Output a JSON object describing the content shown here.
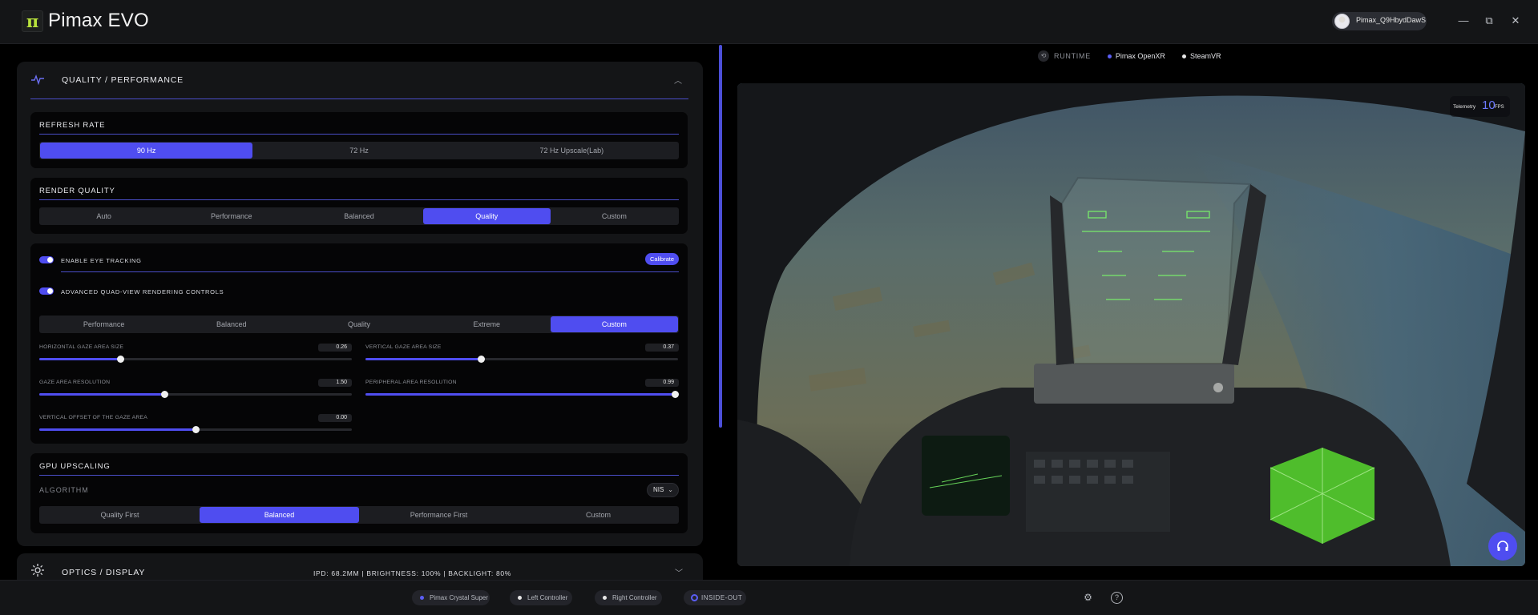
{
  "app": {
    "title": "Pimax EVO",
    "logo_glyph": "π",
    "user_name": "Pimax_Q9HbydDawS"
  },
  "window_controls": {
    "minimize": "—",
    "restore": "⧉",
    "close": "✕"
  },
  "quality_section": {
    "title": "QUALITY / PERFORMANCE",
    "icon": "activity-icon",
    "refresh_rate": {
      "title": "REFRESH RATE",
      "options": [
        "90 Hz",
        "72 Hz",
        "72 Hz Upscale(Lab)"
      ],
      "selected": "90 Hz"
    },
    "render_quality": {
      "title": "RENDER QUALITY",
      "options": [
        "Auto",
        "Performance",
        "Balanced",
        "Quality",
        "Custom"
      ],
      "selected": "Quality"
    },
    "eye_tracking": {
      "label": "ENABLE EYE TRACKING",
      "enabled": true,
      "calibrate_label": "Calibrate"
    },
    "quad_view": {
      "label": "ADVANCED QUAD-VIEW RENDERING CONTROLS",
      "enabled": true,
      "options": [
        "Performance",
        "Balanced",
        "Quality",
        "Extreme",
        "Custom"
      ],
      "selected": "Custom",
      "sliders": [
        {
          "label": "HORIZONTAL GAZE AREA SIZE",
          "value": "0.26",
          "fill_fraction": 0.26
        },
        {
          "label": "VERTICAL GAZE AREA SIZE",
          "value": "0.37",
          "fill_fraction": 0.37
        },
        {
          "label": "GAZE AREA RESOLUTION",
          "value": "1.50",
          "fill_fraction": 0.4
        },
        {
          "label": "PERIPHERAL AREA RESOLUTION",
          "value": "0.99",
          "fill_fraction": 0.99
        },
        {
          "label": "VERTICAL OFFSET OF THE GAZE AREA",
          "value": "0.00",
          "fill_fraction": 0.5
        }
      ]
    },
    "gpu_upscaling": {
      "title": "GPU UPSCALING",
      "algorithm_label": "ALGORITHM",
      "algorithm_value": "NIS",
      "options": [
        "Quality First",
        "Balanced",
        "Performance First",
        "Custom"
      ],
      "selected": "Balanced"
    }
  },
  "optics_section": {
    "title": "OPTICS / DISPLAY",
    "info": "IPD: 68.2MM | BRIGHTNESS: 100% | BACKLIGHT: 80%"
  },
  "runtime": {
    "label": "RUNTIME",
    "options": [
      {
        "name": "Pimax OpenXR",
        "color": "#5b5ef5"
      },
      {
        "name": "SteamVR",
        "color": "#e6e6e6"
      }
    ]
  },
  "telemetry": {
    "label": "Telemetry",
    "value": "10",
    "unit": "FPS"
  },
  "devices": [
    {
      "name": "Pimax Crystal Super",
      "dot": "#5b5ef5"
    },
    {
      "name": "Left Controller",
      "dot": "#e6e6e6"
    },
    {
      "name": "Right Controller",
      "dot": "#e6e6e6"
    },
    {
      "name": "INSIDE-OUT",
      "dot": "#5b5ef5"
    }
  ],
  "colors": {
    "accent": "#4f4df0",
    "panel": "#141517",
    "background": "#000000"
  }
}
